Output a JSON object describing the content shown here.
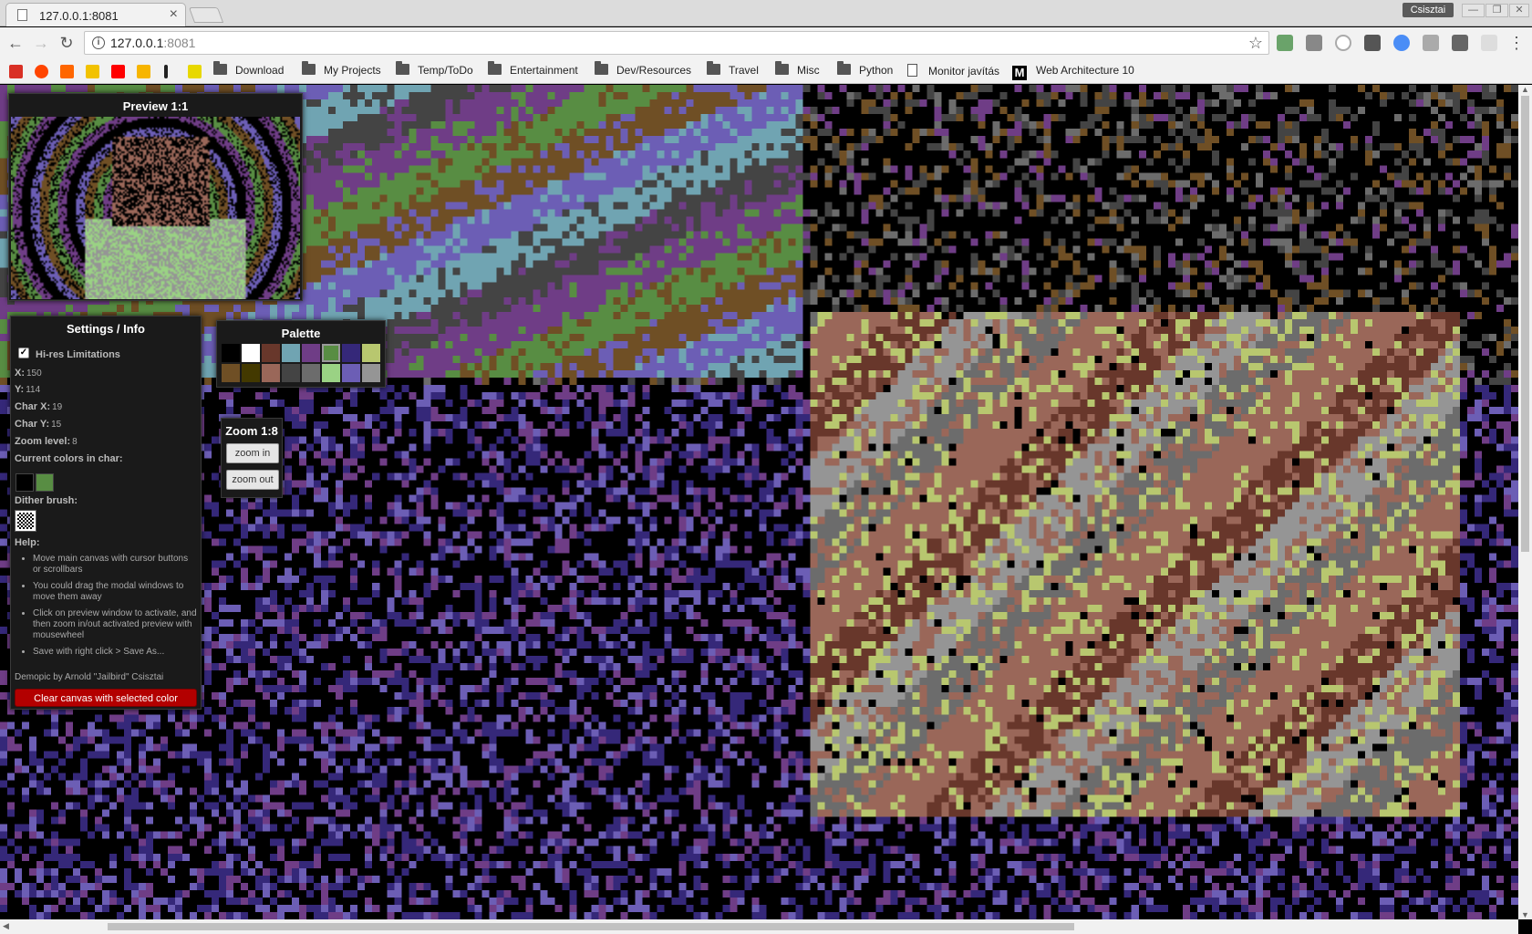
{
  "browser": {
    "tab_title": "127.0.0.1:8081",
    "tab_close": "×",
    "profile_name": "Csisztai",
    "url_host": "127.0.0.1",
    "url_port": ":8081",
    "window_controls": [
      "—",
      "❐",
      "✕"
    ],
    "nav": {
      "back": "←",
      "forward": "→",
      "reload": "↻"
    },
    "star": "☆",
    "extension_icons": [
      "js-icon",
      "camera-icon",
      "circle-icon",
      "download-icon",
      "globe-icon",
      "puzzle-icon",
      "shield-icon",
      "mi-ra-icon"
    ],
    "menu_icon": "⋮"
  },
  "bookmarks": {
    "icons": [
      {
        "name": "gmail-icon",
        "color": "#d93025"
      },
      {
        "name": "reddit-icon",
        "color": "#ff4500"
      },
      {
        "name": "hackernews-icon",
        "color": "#ff6600"
      },
      {
        "name": "lamp-icon",
        "color": "#f2c200"
      },
      {
        "name": "youtube-icon",
        "color": "#ff0000"
      },
      {
        "name": "keep-icon",
        "color": "#f7b500"
      },
      {
        "name": "info-icon",
        "color": "#222222"
      },
      {
        "name": "x-icon",
        "color": "#e8d800"
      }
    ],
    "folders": [
      "Download",
      "My Projects",
      "Temp/ToDo",
      "Entertainment",
      "Dev/Resources",
      "Travel",
      "Misc",
      "Python"
    ],
    "page_link": "Monitor javítás",
    "last_link": "Web Architecture 10"
  },
  "preview": {
    "title": "Preview 1:1"
  },
  "settings": {
    "title": "Settings / Info",
    "hires_label": "Hi-res Limitations",
    "hires_checked": true,
    "x_label": "X:",
    "x_value": "150",
    "y_label": "Y:",
    "y_value": "114",
    "charx_label": "Char X:",
    "charx_value": "19",
    "chary_label": "Char Y:",
    "chary_value": "15",
    "zoom_label": "Zoom level:",
    "zoom_value": "8",
    "current_colors_label": "Current colors in char:",
    "current_colors": [
      "#000000",
      "#588d43"
    ],
    "dither_label": "Dither brush:",
    "help_label": "Help:",
    "help_items": [
      "Move main canvas with cursor buttons or scrollbars",
      "You could drag the modal windows to move them away",
      "Click on preview window to activate, and then zoom in/out activated preview with mousewheel",
      "Save with right click > Save As..."
    ],
    "credit": "Demopic by Arnold \"Jailbird\" Csisztai",
    "clear_button": "Clear canvas with selected color"
  },
  "palette": {
    "title": "Palette",
    "selected_index": 5,
    "colors": [
      "#000000",
      "#ffffff",
      "#68372b",
      "#70a4b2",
      "#6f3d86",
      "#588d43",
      "#352879",
      "#b8c76f",
      "#6f4f25",
      "#433900",
      "#9a6759",
      "#444444",
      "#6c6c6c",
      "#9ad284",
      "#6c5eb5",
      "#959595"
    ]
  },
  "zoom": {
    "title": "Zoom 1:8",
    "zoom_in": "zoom in",
    "zoom_out": "zoom out"
  }
}
